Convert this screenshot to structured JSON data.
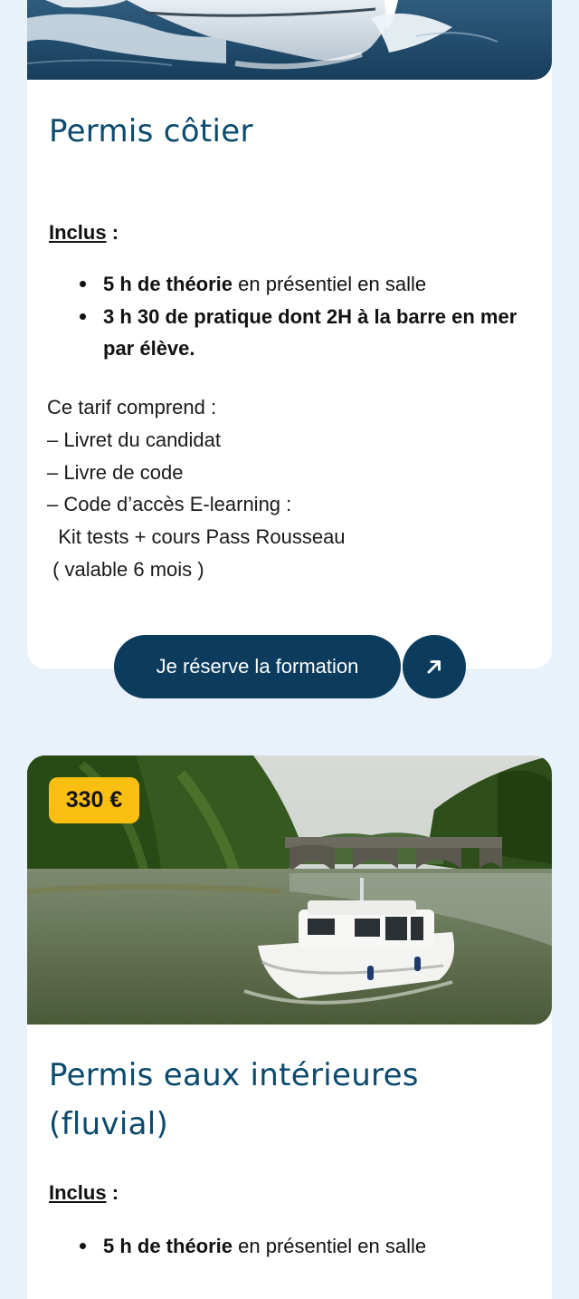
{
  "cards": [
    {
      "title": "Permis côtier",
      "inclus_label": "Inclus",
      "inclus_suffix": " :",
      "bullets": [
        {
          "strong": "5 h de théorie",
          "rest": " en présentiel en salle"
        },
        {
          "strong": "3 h 30 de pratique dont 2H à la barre en mer par élève.",
          "rest": ""
        }
      ],
      "tarif_lines": [
        "Ce tarif comprend :",
        "– Livret du candidat",
        "– Livre de code",
        "– Code d’accès E-learning :",
        "  Kit tests + cours Pass Rousseau",
        " ( valable 6 mois )"
      ],
      "cta_label": "Je réserve la formation",
      "cta_icon": "arrow-up-right-icon"
    },
    {
      "price": "330 €",
      "title": "Permis eaux intérieures (fluvial)",
      "inclus_label": "Inclus",
      "inclus_suffix": " :",
      "bullets": [
        {
          "strong": "5 h de théorie",
          "rest": " en présentiel en salle"
        }
      ]
    }
  ],
  "colors": {
    "page_background": "#e9f2fa",
    "title": "#0a4a6e",
    "button": "#0b3c5d",
    "price_badge": "#fbbf12"
  }
}
